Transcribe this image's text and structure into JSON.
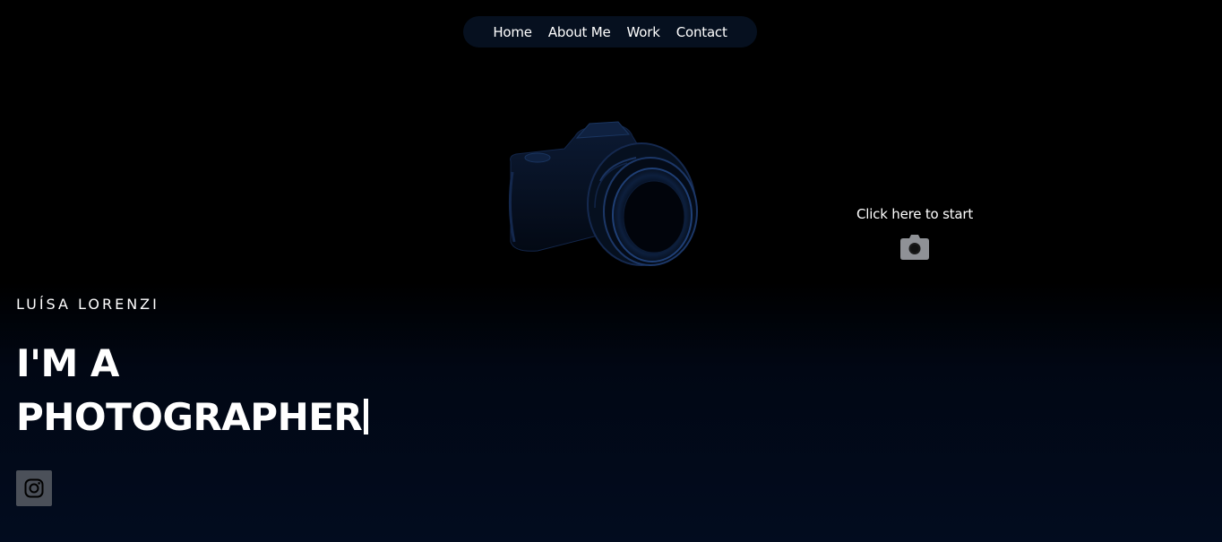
{
  "nav": {
    "items": [
      {
        "label": "Home"
      },
      {
        "label": "About Me"
      },
      {
        "label": "Work"
      },
      {
        "label": "Contact"
      }
    ]
  },
  "hero": {
    "owner_name": "LUÍSA LORENZI",
    "headline_line1": "I'M A",
    "headline_line2": "PHOTOGRAPHER",
    "cta_label": "Click here to start",
    "cta_icon": "camera-icon",
    "camera_image": "camera-photo"
  },
  "social": {
    "instagram_icon": "instagram-icon"
  },
  "colors": {
    "background": "#000000",
    "gradient_bottom": "#020c1f",
    "nav_background": "#06101f",
    "social_button": "#4b5059",
    "camera_tint": "#0b1a33"
  }
}
